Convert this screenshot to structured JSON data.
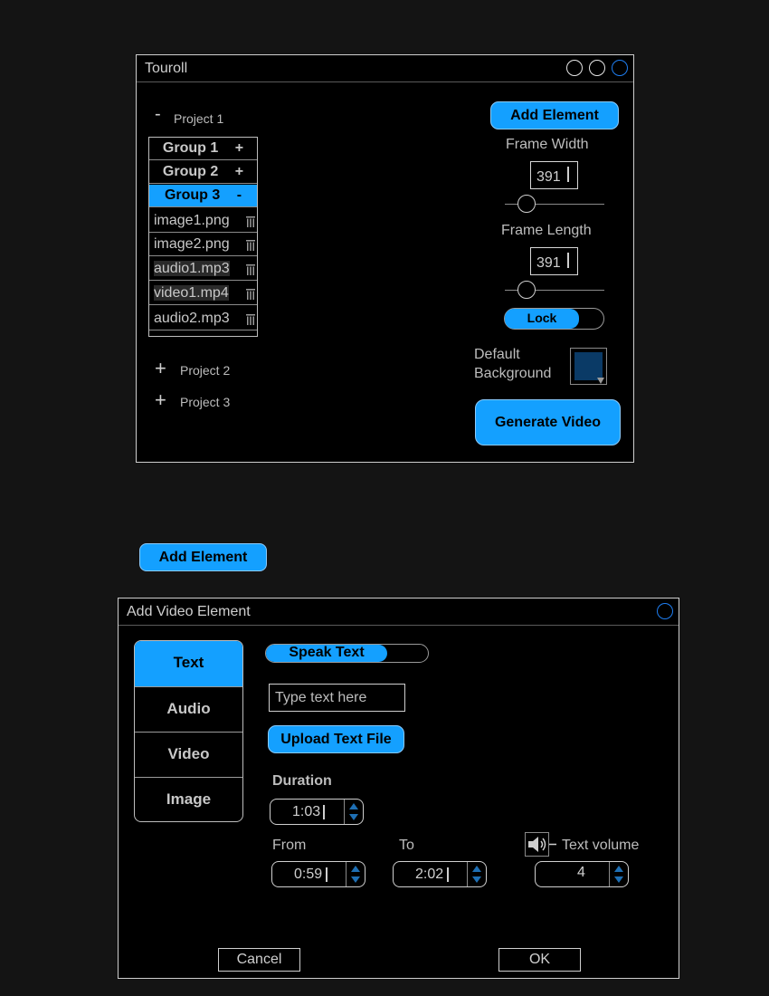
{
  "main_window": {
    "title": "Touroll",
    "projects": [
      {
        "toggle": "-",
        "label": "Project 1"
      },
      {
        "toggle": "+",
        "label": "Project 2"
      },
      {
        "toggle": "+",
        "label": "Project 3"
      }
    ],
    "groups": [
      {
        "label": "Group 1",
        "toggle": "+"
      },
      {
        "label": "Group 2",
        "toggle": "+"
      },
      {
        "label": "Group 3",
        "toggle": "-"
      }
    ],
    "files": [
      "image1.png",
      "image2.png",
      "audio1.mp3",
      "video1.mp4",
      "audio2.mp3"
    ],
    "add_element_label": "Add Element",
    "frame_width_label": "Frame Width",
    "frame_width_value": "391",
    "frame_length_label": "Frame Length",
    "frame_length_value": "391",
    "lock_label": "Lock",
    "default_background_label_1": "Default",
    "default_background_label_2": "Background",
    "background_color": "#0a3a66",
    "generate_label": "Generate Video"
  },
  "floating_add_element_label": "Add Element",
  "dialog": {
    "title": "Add Video Element",
    "tabs": [
      "Text",
      "Audio",
      "Video",
      "Image"
    ],
    "active_tab": "Text",
    "speak_text_label": "Speak Text",
    "text_placeholder": "Type text here",
    "upload_label": "Upload Text File",
    "duration_label": "Duration",
    "duration_value": "1:03",
    "from_label": "From",
    "from_value": "0:59",
    "to_label": "To",
    "to_value": "2:02",
    "text_volume_label": "Text volume",
    "volume_value": "4",
    "cancel_label": "Cancel",
    "ok_label": "OK"
  },
  "colors": {
    "accent": "#14a0ff",
    "window_bg": "#000000",
    "page_bg": "#141414"
  }
}
